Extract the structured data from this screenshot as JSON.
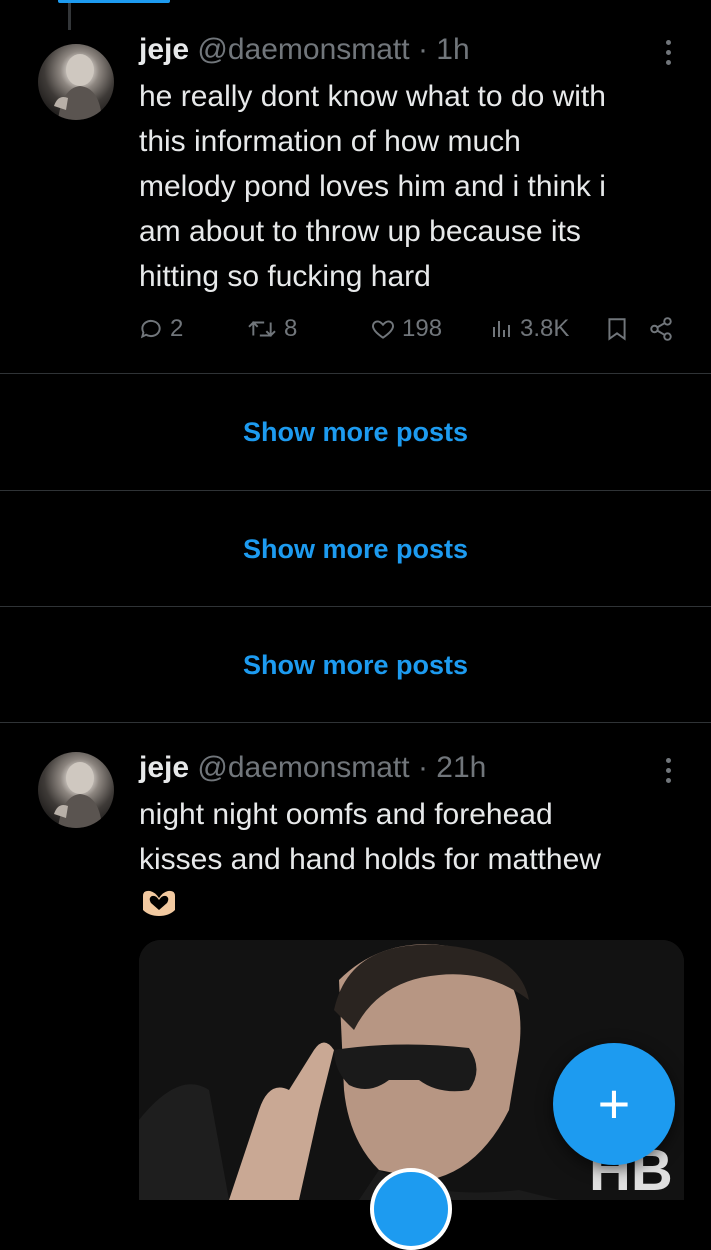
{
  "posts": [
    {
      "name": "jeje",
      "handle": "@daemonsmatt",
      "time": "· 1h",
      "lines": [
        "he really dont know what to do with",
        "this information of how much",
        "melody pond loves him and i think i",
        "am about to throw up because its",
        "hitting so fucking hard"
      ],
      "stats": {
        "replies": "2",
        "reposts": "8",
        "likes": "198",
        "views": "3.8K"
      }
    },
    {
      "name": "jeje",
      "handle": "@daemonsmatt",
      "time": "· 21h",
      "lines": [
        "night night oomfs and forehead",
        "kisses and hand holds for matthew"
      ],
      "emoji": "heart-hands-emoji"
    }
  ],
  "show_more": [
    "Show more posts",
    "Show more posts",
    "Show more posts"
  ],
  "media_watermark": "HB",
  "compose_label": "+",
  "colors": {
    "accent": "#1d9bf0",
    "background": "#000000",
    "muted": "#71767b",
    "text": "#e7e9ea",
    "divider": "#2f3336"
  }
}
